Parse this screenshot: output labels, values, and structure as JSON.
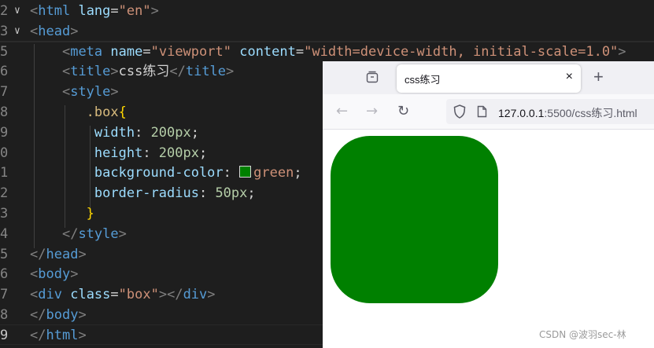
{
  "editor": {
    "lines": [
      {
        "num": "2",
        "fold": "v",
        "tokens": [
          [
            "tag-bracket",
            "<"
          ],
          [
            "tag",
            "html"
          ],
          [
            "",
            " "
          ],
          [
            "attr",
            "lang"
          ],
          [
            "",
            "="
          ],
          [
            "str",
            "\"en\""
          ],
          [
            "tag-bracket",
            ">"
          ]
        ]
      },
      {
        "num": "3",
        "fold": "v",
        "tokens": [
          [
            "tag-bracket",
            "<"
          ],
          [
            "tag",
            "head"
          ],
          [
            "tag-bracket",
            ">"
          ]
        ]
      },
      {
        "num": "5",
        "fold": "",
        "tokens": [
          [
            "",
            "    "
          ],
          [
            "tag-bracket",
            "<"
          ],
          [
            "tag",
            "meta"
          ],
          [
            "",
            " "
          ],
          [
            "attr",
            "name"
          ],
          [
            "",
            "="
          ],
          [
            "str",
            "\"viewport\""
          ],
          [
            "",
            " "
          ],
          [
            "attr",
            "content"
          ],
          [
            "",
            "="
          ],
          [
            "str",
            "\"width=device-width, initial-scale=1.0\""
          ],
          [
            "tag-bracket",
            ">"
          ]
        ]
      },
      {
        "num": "6",
        "fold": "",
        "tokens": [
          [
            "",
            "    "
          ],
          [
            "tag-bracket",
            "<"
          ],
          [
            "tag",
            "title"
          ],
          [
            "tag-bracket",
            ">"
          ],
          [
            "",
            "css练习"
          ],
          [
            "tag-bracket",
            "</"
          ],
          [
            "tag",
            "title"
          ],
          [
            "tag-bracket",
            ">"
          ]
        ]
      },
      {
        "num": "7",
        "fold": "",
        "tokens": [
          [
            "",
            "    "
          ],
          [
            "tag-bracket",
            "<"
          ],
          [
            "tag",
            "style"
          ],
          [
            "tag-bracket",
            ">"
          ]
        ]
      },
      {
        "num": "8",
        "fold": "",
        "tokens": [
          [
            "",
            "       "
          ],
          [
            "sel",
            ".box"
          ],
          [
            "brace",
            "{"
          ]
        ]
      },
      {
        "num": "9",
        "fold": "",
        "tokens": [
          [
            "",
            "        "
          ],
          [
            "prop",
            "width"
          ],
          [
            "",
            ": "
          ],
          [
            "num",
            "200px"
          ],
          [
            "",
            ";"
          ]
        ]
      },
      {
        "num": "0",
        "fold": "",
        "tokens": [
          [
            "",
            "        "
          ],
          [
            "prop",
            "height"
          ],
          [
            "",
            ": "
          ],
          [
            "num",
            "200px"
          ],
          [
            "",
            ";"
          ]
        ]
      },
      {
        "num": "1",
        "fold": "",
        "tokens": [
          [
            "",
            "        "
          ],
          [
            "prop",
            "background-color"
          ],
          [
            "",
            ": "
          ],
          [
            "swatch",
            ""
          ],
          [
            "val",
            "green"
          ],
          [
            "",
            ";"
          ]
        ]
      },
      {
        "num": "2",
        "fold": "",
        "tokens": [
          [
            "",
            "        "
          ],
          [
            "prop",
            "border-radius"
          ],
          [
            "",
            ": "
          ],
          [
            "num",
            "50px"
          ],
          [
            "",
            ";"
          ]
        ]
      },
      {
        "num": "3",
        "fold": "",
        "tokens": [
          [
            "",
            "       "
          ],
          [
            "brace",
            "}"
          ]
        ]
      },
      {
        "num": "4",
        "fold": "",
        "tokens": [
          [
            "",
            "    "
          ],
          [
            "tag-bracket",
            "</"
          ],
          [
            "tag",
            "style"
          ],
          [
            "tag-bracket",
            ">"
          ]
        ]
      },
      {
        "num": "5",
        "fold": "",
        "tokens": [
          [
            "tag-bracket",
            "</"
          ],
          [
            "tag",
            "head"
          ],
          [
            "tag-bracket",
            ">"
          ]
        ]
      },
      {
        "num": "6",
        "fold": "",
        "tokens": [
          [
            "tag-bracket",
            "<"
          ],
          [
            "tag",
            "body"
          ],
          [
            "tag-bracket",
            ">"
          ]
        ]
      },
      {
        "num": "7",
        "fold": "",
        "tokens": [
          [
            "tag-bracket",
            "<"
          ],
          [
            "tag",
            "div"
          ],
          [
            "",
            " "
          ],
          [
            "attr",
            "class"
          ],
          [
            "",
            "="
          ],
          [
            "str",
            "\"box\""
          ],
          [
            "tag-bracket",
            "></"
          ],
          [
            "tag",
            "div"
          ],
          [
            "tag-bracket",
            ">"
          ]
        ]
      },
      {
        "num": "8",
        "fold": "",
        "tokens": [
          [
            "tag-bracket",
            "</"
          ],
          [
            "tag",
            "body"
          ],
          [
            "tag-bracket",
            ">"
          ]
        ]
      },
      {
        "num": "9",
        "fold": "",
        "tokens": [
          [
            "tag-bracket",
            "</"
          ],
          [
            "tag",
            "html"
          ],
          [
            "tag-bracket",
            ">"
          ]
        ]
      }
    ],
    "swatch_color": "#008000"
  },
  "browser": {
    "tab_title": "css练习",
    "tab_close": "×",
    "new_tab": "+",
    "url_host": "127.0.0.1",
    "url_rest": ":5500/css练习.html",
    "box_color": "#008000"
  },
  "watermark": "CSDN @波羽sec-林"
}
